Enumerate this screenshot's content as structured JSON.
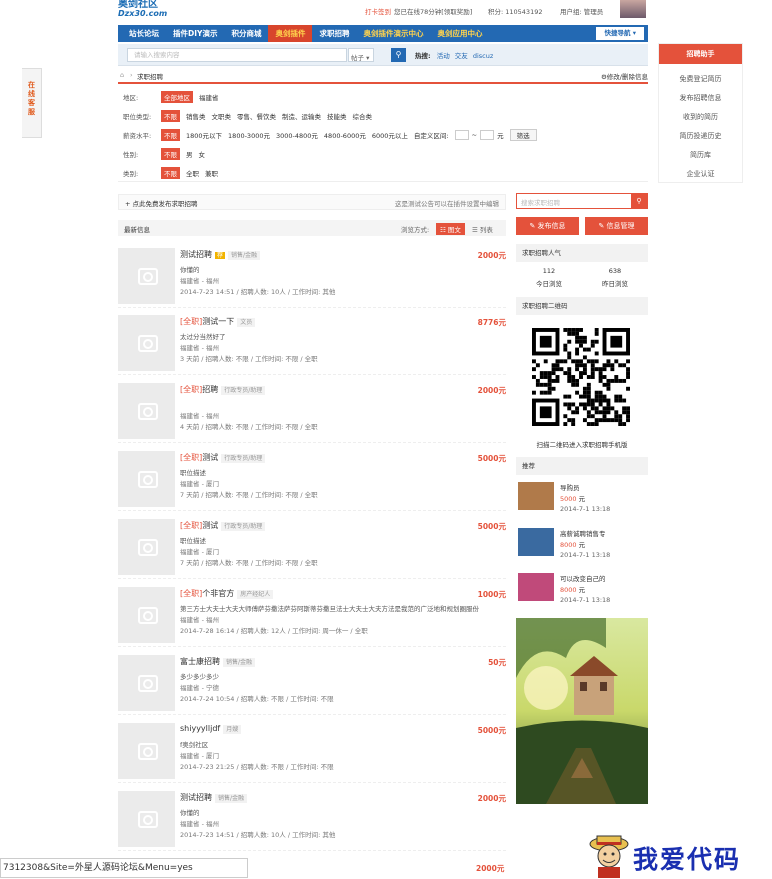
{
  "header": {
    "logo_cn": "奥剑社区",
    "logo_en": "Dzx30.com",
    "signin": "打卡签到",
    "online": "您已在线78分钟[领取奖励]",
    "points": "积分: 110543192",
    "usergroup": "用户组: 管理员"
  },
  "nav": {
    "items": [
      "站长论坛",
      "插件DIY演示",
      "积分商城",
      "奥剑插件",
      "求职招聘",
      "奥剑插件演示中心",
      "奥剑应用中心"
    ],
    "quick": "快捷导航"
  },
  "search": {
    "placeholder": "请输入搜索内容",
    "type": "帖子",
    "hot_label": "热搜:",
    "hot": [
      "活动",
      "交友",
      "discuz"
    ]
  },
  "side_tab": "在线客服",
  "breadcrumb": {
    "current": "求职招聘",
    "right": "修改/删除信息"
  },
  "filters": {
    "region": {
      "label": "地区:",
      "selected": "全部地区",
      "options": [
        "福建省"
      ]
    },
    "jobtype": {
      "label": "职位类型:",
      "selected": "不限",
      "options": [
        "销售类",
        "文职类",
        "零售、餐饮类",
        "制造、运输类",
        "技能类",
        "综合类"
      ]
    },
    "salary": {
      "label": "薪资水平:",
      "selected": "不限",
      "options": [
        "1800元以下",
        "1800-3000元",
        "3000-4800元",
        "4800-6000元",
        "6000元以上"
      ],
      "custom": "自定义区间:",
      "tilde": "~",
      "unit": "元",
      "button": "筛选"
    },
    "gender": {
      "label": "性别:",
      "selected": "不限",
      "options": [
        "男",
        "女"
      ]
    },
    "category": {
      "label": "类别:",
      "selected": "不限",
      "options": [
        "全职",
        "兼职"
      ]
    }
  },
  "postbar": {
    "left": "+ 点此免费发布求职招聘",
    "right": "这是测试公告可以在插件设置中编辑"
  },
  "listbar": {
    "title": "最新信息",
    "view_label": "浏览方式:",
    "view_grid": "图文",
    "view_list": "列表"
  },
  "listings": [
    {
      "tag": "",
      "title": "测试招聘",
      "hot": "荐",
      "cat": "销售/金融",
      "price": "2000元",
      "desc": "你懂的",
      "loc": "福建省 - 福州",
      "meta": "2014-7-23 14:51 / 招聘人数: 10人 / 工作时间: 其他"
    },
    {
      "tag": "[全职]",
      "title": "测试一下",
      "hot": "",
      "cat": "文员",
      "price": "8776元",
      "desc": "太过分当然好了",
      "loc": "福建省 - 福州",
      "meta": "3 天前 / 招聘人数: 不限 / 工作时间: 不限 / 全职"
    },
    {
      "tag": "[全职]",
      "title": "招聘",
      "hot": "",
      "cat": "行政专员/助理",
      "price": "2000元",
      "desc": "",
      "loc": "福建省 - 福州",
      "meta": "4 天前 / 招聘人数: 不限 / 工作时间: 不限 / 全职"
    },
    {
      "tag": "[全职]",
      "title": "测试",
      "hot": "",
      "cat": "行政专员/助理",
      "price": "5000元",
      "desc": "职位描述",
      "loc": "福建省 - 厦门",
      "meta": "7 天前 / 招聘人数: 不限 / 工作时间: 不限 / 全职"
    },
    {
      "tag": "[全职]",
      "title": "测试",
      "hot": "",
      "cat": "行政专员/助理",
      "price": "5000元",
      "desc": "职位描述",
      "loc": "福建省 - 厦门",
      "meta": "7 天前 / 招聘人数: 不限 / 工作时间: 不限 / 全职"
    },
    {
      "tag": "[全职]",
      "title": "个非官方",
      "hot": "",
      "cat": "房产经纪人",
      "price": "1000元",
      "desc": "第三方士大夫士大夫大师傅萨芬撒法萨芬阿斯蒂芬撒旦法士大夫士大夫方法是我范的广泛地和规划圈服份",
      "loc": "福建省 - 福州",
      "meta": "2014-7-28 16:14 / 招聘人数: 12人 / 工作时间: 周一休一 / 全职"
    },
    {
      "tag": "",
      "title": "富士康招聘",
      "hot": "",
      "cat": "销售/金融",
      "price": "50元",
      "desc": "多少多少多少",
      "loc": "福建省 - 宁德",
      "meta": "2014-7-24 10:54 / 招聘人数: 不限 / 工作时间: 不限"
    },
    {
      "tag": "",
      "title": "shiyyylljdf",
      "hot": "",
      "cat": "月嫂",
      "price": "5000元",
      "desc": "f奥剑社区",
      "loc": "福建省 - 厦门",
      "meta": "2014-7-23 21:25 / 招聘人数: 不限 / 工作时间: 不限"
    },
    {
      "tag": "",
      "title": "测试招聘",
      "hot": "",
      "cat": "销售/金融",
      "price": "2000元",
      "desc": "你懂的",
      "loc": "福建省 - 福州",
      "meta": "2014-7-23 14:51 / 招聘人数: 10人 / 工作时间: 其他"
    }
  ],
  "last_price": "2000元",
  "right": {
    "search_placeholder": "搜索求职招聘",
    "publish": "发布信息",
    "manage": "信息管理",
    "pop_title": "求职招聘人气",
    "today_num": "112",
    "today_label": "今日浏览",
    "yest_num": "638",
    "yest_label": "昨日浏览",
    "qr_title": "求职招聘二维码",
    "qr_caption": "扫描二维码进入求职招聘手机版",
    "rec_title": "推荐",
    "rec": [
      {
        "title": "导购员",
        "price": "5000",
        "unit": "元",
        "date": "2014-7-1 13:18"
      },
      {
        "title": "高薪诚聘销售专",
        "price": "8000",
        "unit": "元",
        "date": "2014-7-1 13:18"
      },
      {
        "title": "可以改变自己的",
        "price": "8000",
        "unit": "元",
        "date": "2014-7-1 13:18"
      }
    ]
  },
  "helper": {
    "title": "招聘助手",
    "items": [
      "免费登记简历",
      "发布招聘信息",
      "收到的简历",
      "简历投递历史",
      "简历库",
      "企业认证"
    ]
  },
  "statusbar": "7312308&Site=外星人源码论坛&Menu=yes",
  "watermark": "我爱代码"
}
